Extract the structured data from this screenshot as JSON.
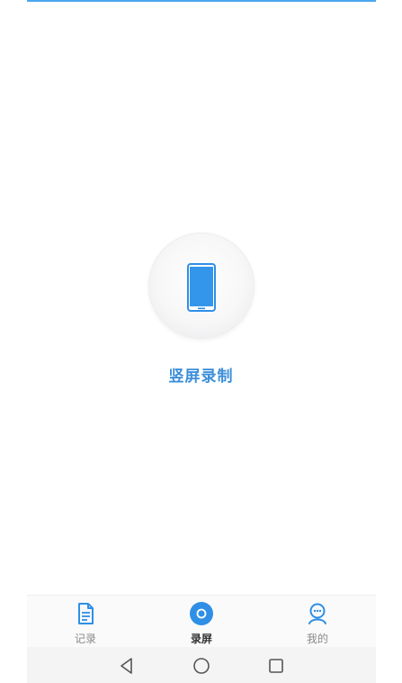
{
  "main": {
    "record_label": "竖屏录制"
  },
  "tabs": [
    {
      "label": "记录",
      "icon": "document-icon",
      "active": false
    },
    {
      "label": "录屏",
      "icon": "record-icon",
      "active": true
    },
    {
      "label": "我的",
      "icon": "profile-icon",
      "active": false
    }
  ],
  "system_nav": {
    "buttons": [
      "back-icon",
      "home-icon",
      "recents-icon"
    ]
  },
  "colors": {
    "accent": "#2f8fe6",
    "label": "#3d8fd9",
    "inactive": "#8a8a8a"
  }
}
